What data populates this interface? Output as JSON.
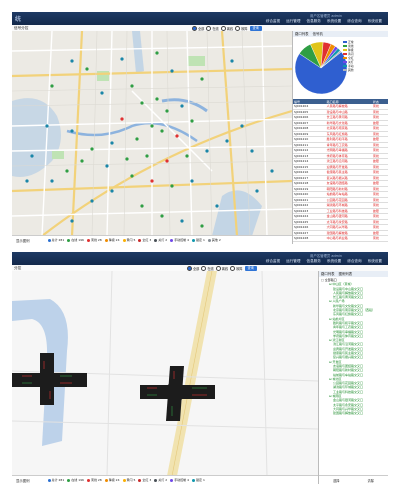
{
  "panel1": {
    "app_title": "统",
    "user_text": "用户名管理员 admin",
    "tabs": [
      "综合监视",
      "运行管理",
      "信息服务",
      "系统设置",
      "综合查询",
      "系统设置"
    ],
    "active_tab": "综合监视",
    "subbar_label": "信号分控",
    "toolbar": {
      "radios": [
        "全部",
        "在线",
        "离线",
        "故障"
      ],
      "button": "查询"
    },
    "bottom_left": "显示图例",
    "legend": [
      {
        "label": "总计 281",
        "color": "#2a6fd1"
      },
      {
        "label": "在线 196",
        "color": "#2f9e44"
      },
      {
        "label": "离线 28",
        "color": "#e03131"
      },
      {
        "label": "降级 24",
        "color": "#f08c00"
      },
      {
        "label": "黄闪 5",
        "color": "#fab005"
      },
      {
        "label": "全红 3",
        "color": "#c92a2a"
      },
      {
        "label": "关灯 2",
        "color": "#495057"
      },
      {
        "label": "手动控制 4",
        "color": "#7048e8"
      },
      {
        "label": "锁定 1",
        "color": "#1098ad"
      },
      {
        "label": "其他 2",
        "color": "#868e96"
      }
    ],
    "side_head": [
      "路口列表",
      "信号机"
    ],
    "pie": {
      "slices": [
        {
          "name": "正常",
          "value": 70,
          "color": "#2f5fd0"
        },
        {
          "name": "离线",
          "value": 9,
          "color": "#2f9e44"
        },
        {
          "name": "降级",
          "value": 8,
          "color": "#e0c51a"
        },
        {
          "name": "黄闪",
          "value": 5,
          "color": "#e03131"
        },
        {
          "name": "全红",
          "value": 3,
          "color": "#f08c00"
        },
        {
          "name": "关灯",
          "value": 2,
          "color": "#7048e8"
        },
        {
          "name": "手动",
          "value": 2,
          "color": "#1098ad"
        },
        {
          "name": "其他",
          "value": 1,
          "color": "#adb5bd"
        }
      ]
    },
    "table": {
      "headers": [
        "编号",
        "路口名称",
        "状态"
      ],
      "rows": [
        [
          "SJ001204",
          "人民路与解放路",
          "离线"
        ],
        [
          "SJ001205",
          "建设路与中山路",
          "离线"
        ],
        [
          "SJ001206",
          "长江路与黄河路",
          "离线"
        ],
        [
          "SJ001207",
          "新华路与文化路",
          "故障"
        ],
        [
          "SJ001208",
          "北京路与南京路",
          "离线"
        ],
        [
          "SJ001209",
          "东风路与红旗路",
          "离线"
        ],
        [
          "SJ001210",
          "胜利路与和平路",
          "故障"
        ],
        [
          "SJ001211",
          "青年路与工农路",
          "离线"
        ],
        [
          "SJ001212",
          "光明路与幸福路",
          "离线"
        ],
        [
          "SJ001213",
          "学府路与体育路",
          "离线"
        ],
        [
          "SJ001214",
          "滨江路与沿河路",
          "故障"
        ],
        [
          "SJ001215",
          "迎宾路与开发路",
          "离线"
        ],
        [
          "SJ001216",
          "健康路与民主路",
          "离线"
        ],
        [
          "SJ001217",
          "复兴路与振兴路",
          "离线"
        ],
        [
          "SJ001218",
          "友谊路与团结路",
          "故障"
        ],
        [
          "SJ001219",
          "朝阳路与新村路",
          "离线"
        ],
        [
          "SJ001220",
          "站前路与车站路",
          "离线"
        ],
        [
          "SJ001221",
          "公园路与花园路",
          "离线"
        ],
        [
          "SJ001222",
          "湖滨路与环城路",
          "离线"
        ],
        [
          "SJ001223",
          "工业路与科技路",
          "故障"
        ],
        [
          "SJ001224",
          "金山路与银河路",
          "离线"
        ],
        [
          "SJ001225",
          "太平路与永安路",
          "离线"
        ],
        [
          "SJ001226",
          "大同路与兴华路",
          "离线"
        ],
        [
          "SJ001227",
          "建国路与解放路",
          "故障"
        ],
        [
          "SJ001228",
          "中心路与商业路",
          "离线"
        ]
      ]
    }
  },
  "panel2": {
    "subbar_label": "分控",
    "toolbar": {
      "radios": [
        "全部",
        "在线",
        "离线",
        "故障"
      ],
      "button": "查询"
    },
    "bottom_left": "显示图例",
    "legend": [
      {
        "label": "总计 281",
        "color": "#2a6fd1"
      },
      {
        "label": "在线 196",
        "color": "#2f9e44"
      },
      {
        "label": "离线 28",
        "color": "#e03131"
      },
      {
        "label": "降级 24",
        "color": "#f08c00"
      },
      {
        "label": "黄闪 5",
        "color": "#fab005"
      },
      {
        "label": "全红 3",
        "color": "#c92a2a"
      },
      {
        "label": "关灯 2",
        "color": "#495057"
      },
      {
        "label": "手动控制 4",
        "color": "#7048e8"
      },
      {
        "label": "锁定 1",
        "color": "#1098ad"
      }
    ],
    "side_head": [
      "路口列表",
      "图例列表"
    ],
    "tree": [
      {
        "t": "g",
        "v": "□ 全部路口"
      },
      {
        "t": "c",
        "v": "⊟ 中山区（東城）"
      },
      {
        "t": "c2",
        "v": "建设路与中山路交叉口"
      },
      {
        "t": "c2",
        "v": "人民路与解放路交叉口"
      },
      {
        "t": "c2",
        "v": "长江路与黄河路交叉口"
      },
      {
        "t": "c",
        "v": "⊟ 人民广场"
      },
      {
        "t": "c2",
        "v": "新华路与文化路交叉口"
      },
      {
        "t": "c2",
        "v": "北京路与南京路交叉口（西段）"
      },
      {
        "t": "c2",
        "v": "东风路与红旗路交叉口"
      },
      {
        "t": "c",
        "v": "⊟ 站前片区"
      },
      {
        "t": "c2",
        "v": "胜利路与和平路交叉口"
      },
      {
        "t": "c2",
        "v": "青年路与工农路交叉口"
      },
      {
        "t": "c2",
        "v": "光明路与幸福路交叉口"
      },
      {
        "t": "c2",
        "v": "学府路与体育路交叉口"
      },
      {
        "t": "c",
        "v": "⊟ 滨江新区"
      },
      {
        "t": "c2",
        "v": "滨江路与沿河路交叉口"
      },
      {
        "t": "c2",
        "v": "迎宾路与开发路交叉口"
      },
      {
        "t": "c2",
        "v": "健康路与民主路交叉口"
      },
      {
        "t": "c2",
        "v": "复兴路与振兴路交叉口"
      },
      {
        "t": "c",
        "v": "⊟ 开发区"
      },
      {
        "t": "c2",
        "v": "友谊路与团结路交叉口"
      },
      {
        "t": "c2",
        "v": "朝阳路与新村路交叉口"
      },
      {
        "t": "c2",
        "v": "站前路与车站路交叉口"
      },
      {
        "t": "c",
        "v": "⊟ 城北区"
      },
      {
        "t": "c2",
        "v": "公园路与花园路交叉口"
      },
      {
        "t": "c2",
        "v": "湖滨路与环城路交叉口"
      },
      {
        "t": "c2",
        "v": "工业路与科技路交叉口"
      },
      {
        "t": "c",
        "v": "⊟ 城南区"
      },
      {
        "t": "c2",
        "v": "金山路与银河路交叉口"
      },
      {
        "t": "c2",
        "v": "太平路与永安路交叉口"
      },
      {
        "t": "c2",
        "v": "大同路与兴华路交叉口"
      },
      {
        "t": "c2",
        "v": "建国路与解放路交叉口"
      }
    ],
    "tree_foot": [
      "选择",
      "清除"
    ]
  },
  "colors": {
    "header": "#1a3560",
    "accent": "#2f74d6"
  }
}
